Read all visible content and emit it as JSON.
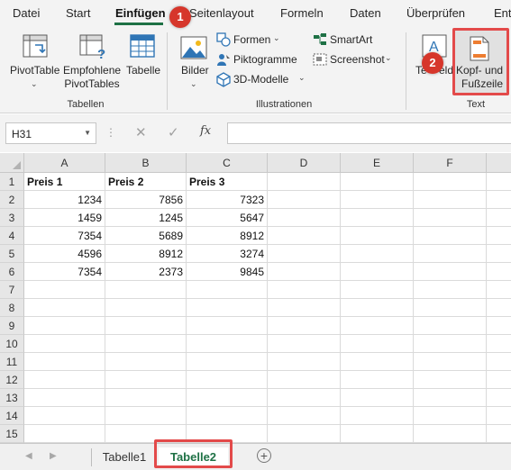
{
  "menu": {
    "tabs": [
      "Datei",
      "Start",
      "Einfügen",
      "Seitenlayout",
      "Formeln",
      "Daten",
      "Überprüfen",
      "Ent"
    ],
    "active": "Einfügen"
  },
  "ribbon": {
    "tabellen": {
      "pivottable": "PivotTable",
      "empfohlene_1": "Empfohlene",
      "empfohlene_2": "PivotTables",
      "tabelle": "Tabelle",
      "group_label": "Tabellen"
    },
    "illustrationen": {
      "bilder": "Bilder",
      "formen": "Formen",
      "piktogramme": "Piktogramme",
      "modelle": "3D-Modelle",
      "smartart": "SmartArt",
      "screenshot": "Screenshot",
      "group_label": "Illustrationen"
    },
    "text": {
      "textfeld_visible": "Te",
      "textfeld_tail": "eld",
      "kopf_1": "Kopf- und",
      "kopf_2": "Fußzeile",
      "group_label": "Text"
    }
  },
  "formula_bar": {
    "name_box": "H31",
    "fx": "fx",
    "value": ""
  },
  "grid": {
    "columns": [
      "A",
      "B",
      "C",
      "D",
      "E",
      "F"
    ],
    "rows": [
      "1",
      "2",
      "3",
      "4",
      "5",
      "6",
      "7",
      "8",
      "9",
      "10",
      "11",
      "12",
      "13",
      "14",
      "15"
    ],
    "headers": [
      "Preis 1",
      "Preis 2",
      "Preis 3"
    ],
    "data": [
      [
        "1234",
        "7856",
        "7323"
      ],
      [
        "1459",
        "1245",
        "5647"
      ],
      [
        "7354",
        "5689",
        "8912"
      ],
      [
        "4596",
        "8912",
        "3274"
      ],
      [
        "7354",
        "2373",
        "9845"
      ]
    ]
  },
  "sheets": {
    "tabs": [
      "Tabelle1",
      "Tabelle2"
    ],
    "active": "Tabelle2"
  },
  "annotations": {
    "badge1": "1",
    "badge2": "2"
  },
  "colors": {
    "accent": "#1e7145",
    "highlight": "#e34a4a",
    "badge": "#d6362b"
  }
}
